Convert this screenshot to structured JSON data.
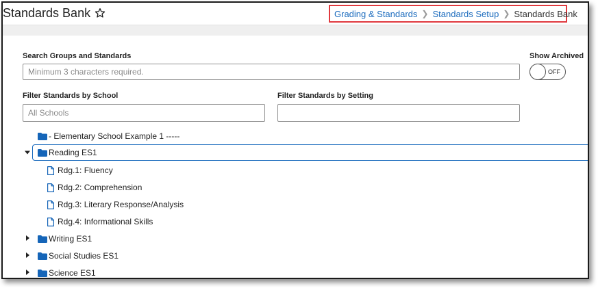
{
  "header": {
    "title": "Standards Bank",
    "breadcrumb": {
      "items": [
        "Grading & Standards",
        "Standards Setup"
      ],
      "current": "Standards Bank",
      "separator": ">"
    }
  },
  "search": {
    "label": "Search Groups and Standards",
    "placeholder": "Minimum 3 characters required.",
    "value": ""
  },
  "show_archived": {
    "label": "Show Archived",
    "state": "OFF"
  },
  "filter_school": {
    "label": "Filter Standards by School",
    "placeholder": "All Schools",
    "value": ""
  },
  "filter_setting": {
    "label": "Filter Standards by Setting",
    "value": ""
  },
  "tree": {
    "root": "- Elementary School Example 1 -----",
    "groups": [
      {
        "label": "Reading ES1",
        "expanded": true,
        "selected": true,
        "children": [
          "Rdg.1: Fluency",
          "Rdg.2: Comprehension",
          "Rdg.3: Literary Response/Analysis",
          "Rdg.4: Informational Skills"
        ]
      },
      {
        "label": "Writing ES1",
        "expanded": false
      },
      {
        "label": "Social Studies ES1",
        "expanded": false
      },
      {
        "label": "Science ES1",
        "expanded": false
      }
    ]
  },
  "colors": {
    "link": "#1b6bbd",
    "folder": "#1565b8",
    "highlight_border": "#e0393e"
  }
}
